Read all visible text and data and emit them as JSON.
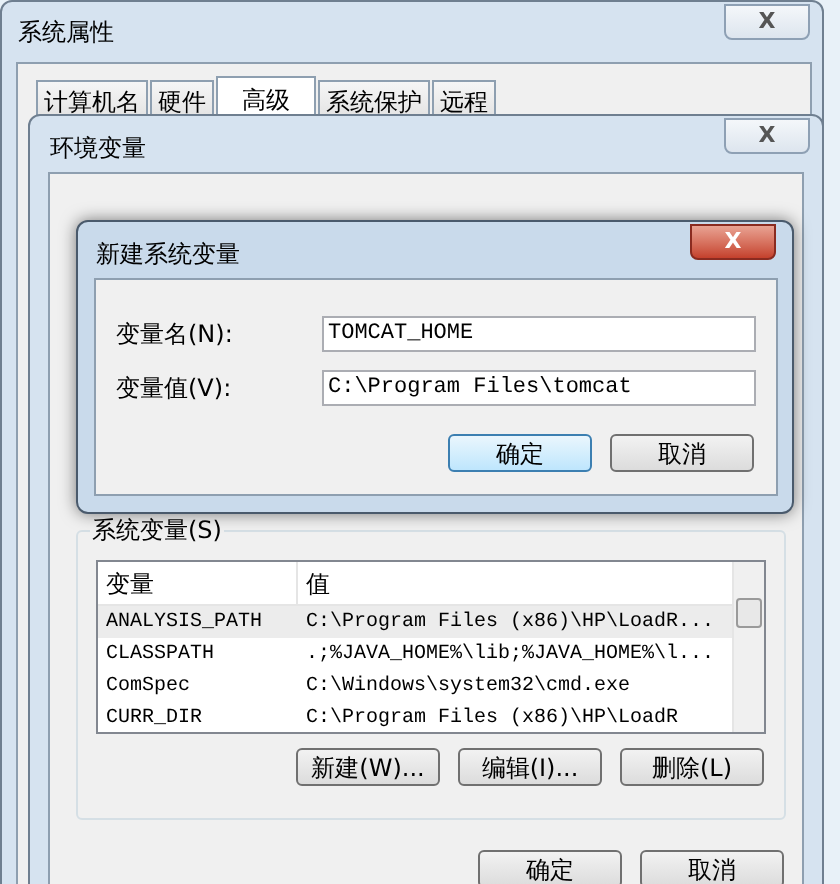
{
  "window": {
    "title": "系统属性",
    "close": "X"
  },
  "tabs": [
    {
      "label": "计算机名",
      "selected": false
    },
    {
      "label": "硬件",
      "selected": false
    },
    {
      "label": "高级",
      "selected": true
    },
    {
      "label": "系统保护",
      "selected": false
    },
    {
      "label": "远程",
      "selected": false
    }
  ],
  "env_window": {
    "title": "环境变量",
    "close": "X",
    "system_vars": {
      "label": "系统变量(S)",
      "columns": [
        "变量",
        "值"
      ],
      "rows": [
        {
          "cells": [
            "ANALYSIS_PATH",
            "C:\\Program Files (x86)\\HP\\LoadR..."
          ],
          "selected": true
        },
        {
          "cells": [
            "CLASSPATH",
            ".;%JAVA_HOME%\\lib;%JAVA_HOME%\\l..."
          ],
          "selected": false
        },
        {
          "cells": [
            "ComSpec",
            "C:\\Windows\\system32\\cmd.exe"
          ],
          "selected": false
        },
        {
          "cells": [
            "CURR_DIR",
            "C:\\Program Files (x86)\\HP\\LoadR"
          ],
          "selected": false
        }
      ],
      "buttons": [
        "新建(W)...",
        "编辑(I)...",
        "删除(L)"
      ]
    },
    "buttons": [
      "确定",
      "取消"
    ]
  },
  "dialog": {
    "title": "新建系统变量",
    "close": "X",
    "fields": [
      {
        "label": "变量名(N):",
        "value": "TOMCAT_HOME"
      },
      {
        "label": "变量值(V):",
        "value": "C:\\Program Files\\tomcat"
      }
    ],
    "buttons": [
      {
        "label": "确定",
        "default": true
      },
      {
        "label": "取消",
        "default": false
      }
    ]
  }
}
